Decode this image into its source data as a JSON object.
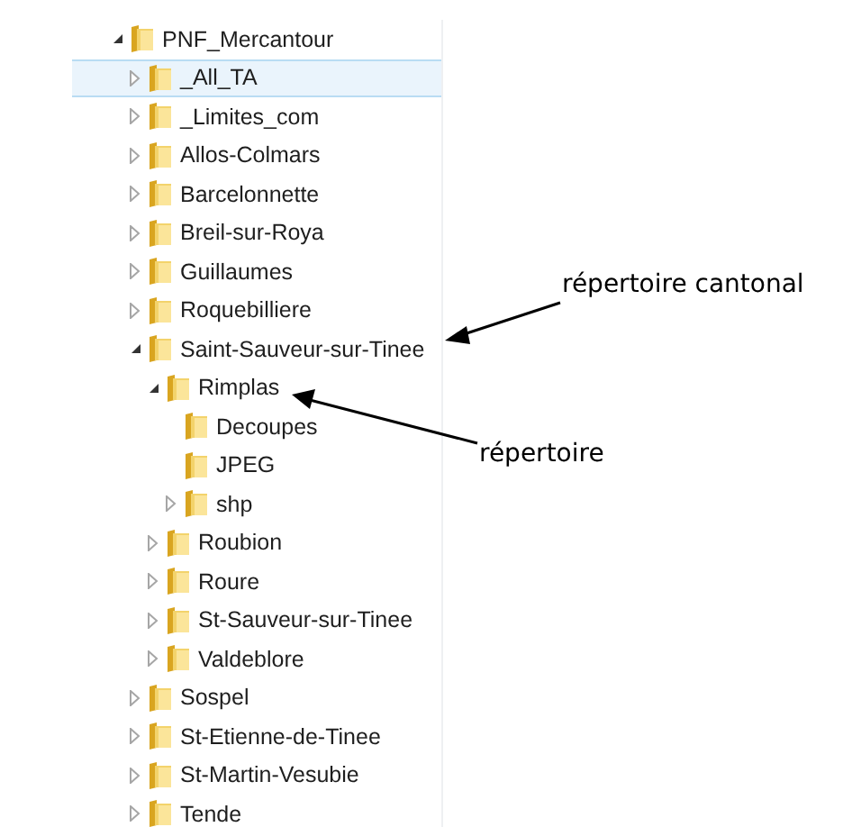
{
  "tree": {
    "label": "PNF_Mercantour",
    "expandable": true,
    "expanded": true,
    "hovered": false,
    "children": [
      {
        "label": "_All_TA",
        "expandable": true,
        "expanded": false,
        "hovered": true
      },
      {
        "label": "_Limites_com",
        "expandable": true,
        "expanded": false,
        "hovered": false
      },
      {
        "label": "Allos-Colmars",
        "expandable": true,
        "expanded": false,
        "hovered": false
      },
      {
        "label": "Barcelonnette",
        "expandable": true,
        "expanded": false,
        "hovered": false
      },
      {
        "label": "Breil-sur-Roya",
        "expandable": true,
        "expanded": false,
        "hovered": false
      },
      {
        "label": "Guillaumes",
        "expandable": true,
        "expanded": false,
        "hovered": false
      },
      {
        "label": "Roquebilliere",
        "expandable": true,
        "expanded": false,
        "hovered": false
      },
      {
        "label": "Saint-Sauveur-sur-Tinee",
        "expandable": true,
        "expanded": true,
        "hovered": false,
        "children": [
          {
            "label": "Rimplas",
            "expandable": true,
            "expanded": true,
            "hovered": false,
            "children": [
              {
                "label": "Decoupes",
                "expandable": false,
                "expanded": false,
                "hovered": false
              },
              {
                "label": "JPEG",
                "expandable": false,
                "expanded": false,
                "hovered": false
              },
              {
                "label": "shp",
                "expandable": true,
                "expanded": false,
                "hovered": false
              }
            ]
          },
          {
            "label": "Roubion",
            "expandable": true,
            "expanded": false,
            "hovered": false
          },
          {
            "label": "Roure",
            "expandable": true,
            "expanded": false,
            "hovered": false
          },
          {
            "label": "St-Sauveur-sur-Tinee",
            "expandable": true,
            "expanded": false,
            "hovered": false
          },
          {
            "label": "Valdeblore",
            "expandable": true,
            "expanded": false,
            "hovered": false
          }
        ]
      },
      {
        "label": "Sospel",
        "expandable": true,
        "expanded": false,
        "hovered": false
      },
      {
        "label": "St-Etienne-de-Tinee",
        "expandable": true,
        "expanded": false,
        "hovered": false
      },
      {
        "label": "St-Martin-Vesubie",
        "expandable": true,
        "expanded": false,
        "hovered": false
      },
      {
        "label": "Tende",
        "expandable": true,
        "expanded": false,
        "hovered": false
      }
    ]
  },
  "annotations": [
    {
      "text": "répertoire cantonal"
    },
    {
      "text": "répertoire"
    }
  ]
}
